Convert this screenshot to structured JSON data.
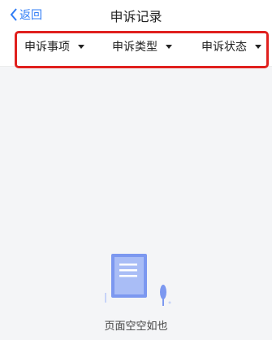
{
  "header": {
    "back_label": "返回",
    "title": "申诉记录"
  },
  "filters": [
    {
      "label": "申诉事项"
    },
    {
      "label": "申诉类型"
    },
    {
      "label": "申诉状态"
    }
  ],
  "empty_state": {
    "message": "页面空空如也"
  },
  "colors": {
    "accent": "#2f7cf6",
    "highlight_border": "#e0201e",
    "background": "#f4f5f7"
  }
}
